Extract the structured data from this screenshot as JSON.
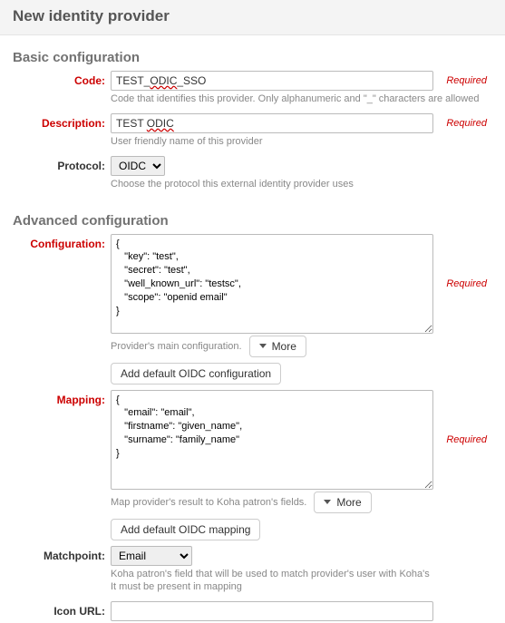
{
  "header": {
    "title": "New identity provider"
  },
  "basic": {
    "legend": "Basic configuration",
    "code": {
      "label": "Code:",
      "value": "TEST_ODIC_SSO",
      "help": "Code that identifies this provider. Only alphanumeric and \"_\" characters are allowed",
      "required": "Required"
    },
    "description": {
      "label": "Description:",
      "value": "TEST ODIC",
      "help": "User friendly name of this provider",
      "required": "Required"
    },
    "protocol": {
      "label": "Protocol:",
      "value": "OIDC",
      "help": "Choose the protocol this external identity provider uses"
    }
  },
  "advanced": {
    "legend": "Advanced configuration",
    "configuration": {
      "label": "Configuration:",
      "value": "{\n   \"key\": \"test\",\n   \"secret\": \"test\",\n   \"well_known_url\": \"testsc\",\n   \"scope\": \"openid email\"\n}",
      "help": "Provider's main configuration.",
      "more": "More",
      "add_default": "Add default OIDC configuration",
      "required": "Required"
    },
    "mapping": {
      "label": "Mapping:",
      "value": "{\n   \"email\": \"email\",\n   \"firstname\": \"given_name\",\n   \"surname\": \"family_name\"\n}",
      "help": "Map provider's result to Koha patron's fields.",
      "more": "More",
      "add_default": "Add default OIDC mapping",
      "required": "Required"
    },
    "matchpoint": {
      "label": "Matchpoint:",
      "value": "Email",
      "help": "Koha patron's field that will be used to match provider's user with Koha's\nIt must be present in mapping"
    },
    "icon_url": {
      "label": "Icon URL:",
      "value": ""
    }
  }
}
